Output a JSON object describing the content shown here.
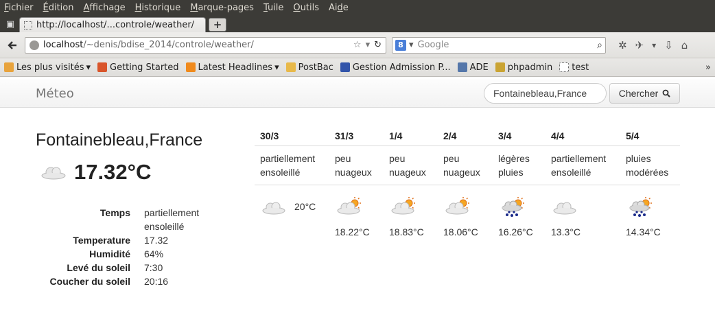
{
  "menu": [
    {
      "pre": "",
      "key": "F",
      "post": "ichier"
    },
    {
      "pre": "",
      "key": "É",
      "post": "dition"
    },
    {
      "pre": "",
      "key": "A",
      "post": "ffichage"
    },
    {
      "pre": "",
      "key": "H",
      "post": "istorique"
    },
    {
      "pre": "",
      "key": "M",
      "post": "arque-pages"
    },
    {
      "pre": "",
      "key": "T",
      "post": "uile"
    },
    {
      "pre": "",
      "key": "O",
      "post": "utils"
    },
    {
      "pre": "Ai",
      "key": "d",
      "post": "e"
    }
  ],
  "tab": {
    "title": "http://localhost/...controle/weather/"
  },
  "url": {
    "host": "localhost",
    "path": "/~denis/bdise_2014/controle/weather/"
  },
  "search_engine": {
    "placeholder": "Google"
  },
  "bookmarks": [
    {
      "label": "Les plus visités",
      "arrow": "▾",
      "color": "#e8a33c"
    },
    {
      "label": "Getting Started",
      "arrow": "",
      "color": "#d9552b"
    },
    {
      "label": "Latest Headlines",
      "arrow": "▾",
      "color": "#f08a1c"
    },
    {
      "label": "PostBac",
      "arrow": "",
      "color": "#e8b94a"
    },
    {
      "label": "Gestion Admission P...",
      "arrow": "",
      "color": "#3355aa"
    },
    {
      "label": "ADE",
      "arrow": "",
      "color": "#5577aa"
    },
    {
      "label": "phpadmin",
      "arrow": "",
      "color": "#caa434"
    },
    {
      "label": "test",
      "arrow": "",
      "color": "#ffffff"
    }
  ],
  "bookmarks_more": "»",
  "site": {
    "brand": "Méteo",
    "search_value": "Fontainebleau,France",
    "search_button": "Chercher"
  },
  "current": {
    "city": "Fontainebleau,France",
    "temp": "17.32°C",
    "icon": "cloud-icon",
    "details": [
      {
        "k": "Temps",
        "v": "partiellement ensoleillé"
      },
      {
        "k": "Temperature",
        "v": "17.32"
      },
      {
        "k": "Humidité",
        "v": "64%"
      },
      {
        "k": "Levé du soleil",
        "v": "7:30"
      },
      {
        "k": "Coucher du soleil",
        "v": "20:16"
      }
    ]
  },
  "forecast": [
    {
      "date": "30/3",
      "desc": "partiellement ensoleillé",
      "icon": "cloud",
      "temp": "20°C",
      "inline": true
    },
    {
      "date": "31/3",
      "desc": "peu nuageux",
      "icon": "sun-cloud",
      "temp": "18.22°C",
      "inline": false
    },
    {
      "date": "1/4",
      "desc": "peu nuageux",
      "icon": "sun-cloud",
      "temp": "18.83°C",
      "inline": false
    },
    {
      "date": "2/4",
      "desc": "peu nuageux",
      "icon": "sun-cloud",
      "temp": "18.06°C",
      "inline": false
    },
    {
      "date": "3/4",
      "desc": "légères pluies",
      "icon": "rain",
      "temp": "16.26°C",
      "inline": false
    },
    {
      "date": "4/4",
      "desc": "partiellement ensoleillé",
      "icon": "cloud",
      "temp": "13.3°C",
      "inline": false
    },
    {
      "date": "5/4",
      "desc": "pluies modérées",
      "icon": "rain",
      "temp": "14.34°C",
      "inline": false
    }
  ]
}
